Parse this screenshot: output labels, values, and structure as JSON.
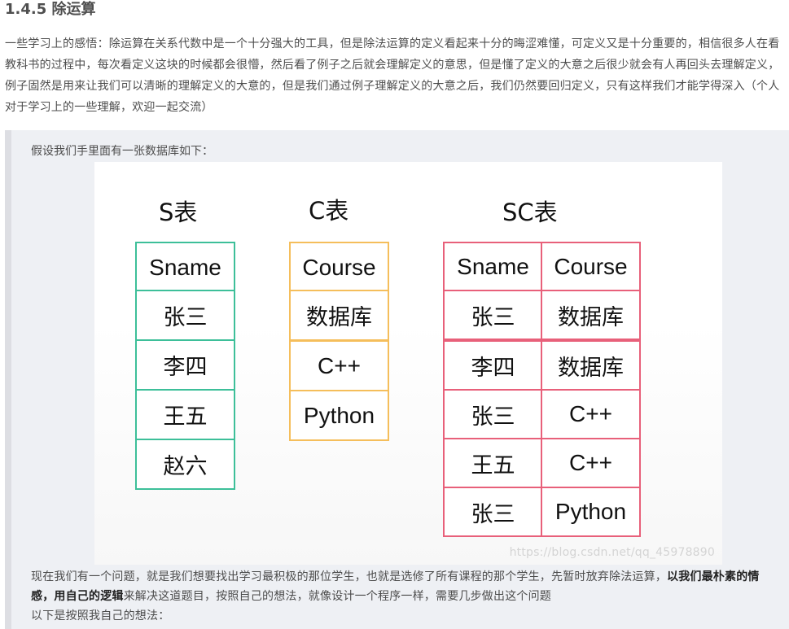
{
  "heading": "1.4.5 除运算",
  "intro": "一些学习上的感悟：除运算在关系代数中是一个十分强大的工具，但是除法运算的定义看起来十分的晦涩难懂，可定义又是十分重要的，相信很多人在看教科书的过程中，每次看定义这块的时候都会很懵，然后看了例子之后就会理解定义的意思，但是懂了定义的大意之后很少就会有人再回头去理解定义，例子固然是用来让我们可以清晰的理解定义的大意的，但是我们通过例子理解定义的大意之后，我们仍然要回归定义，只有这样我们才能学得深入（个人对于学习上的一些理解，欢迎一起交流）",
  "quote": {
    "line1": "假设我们手里面有一张数据库如下：",
    "para_a": "现在我们有一个问题，就是我们想要找出学习最积极的那位学生，也就是选修了所有课程的那个学生，先暂时放弃除法运算，",
    "para_bold1": "以我们最朴素的情感，用自己的逻辑",
    "para_b": "来解决这道题目，按照自己的想法，就像设计一个程序一样，需要几步做出这个问题",
    "para_c": "以下是按照我自己的想法："
  },
  "figure": {
    "s_table": {
      "title": "S表",
      "color": "#3dbf99",
      "rows": [
        "Sname",
        "张三",
        "李四",
        "王五",
        "赵六"
      ]
    },
    "c_table": {
      "title": "C表",
      "color": "#f5be5b",
      "rows": [
        "Course",
        "数据库",
        "C++",
        "Python"
      ]
    },
    "sc_table": {
      "title": "SC表",
      "color": "#e8607a",
      "rows": [
        [
          "Sname",
          "Course"
        ],
        [
          "张三",
          "数据库"
        ],
        [
          "李四",
          "数据库"
        ],
        [
          "张三",
          "C++"
        ],
        [
          "王五",
          "C++"
        ],
        [
          "张三",
          "Python"
        ]
      ]
    },
    "watermark": "https://blog.csdn.net/qq_45978890"
  }
}
